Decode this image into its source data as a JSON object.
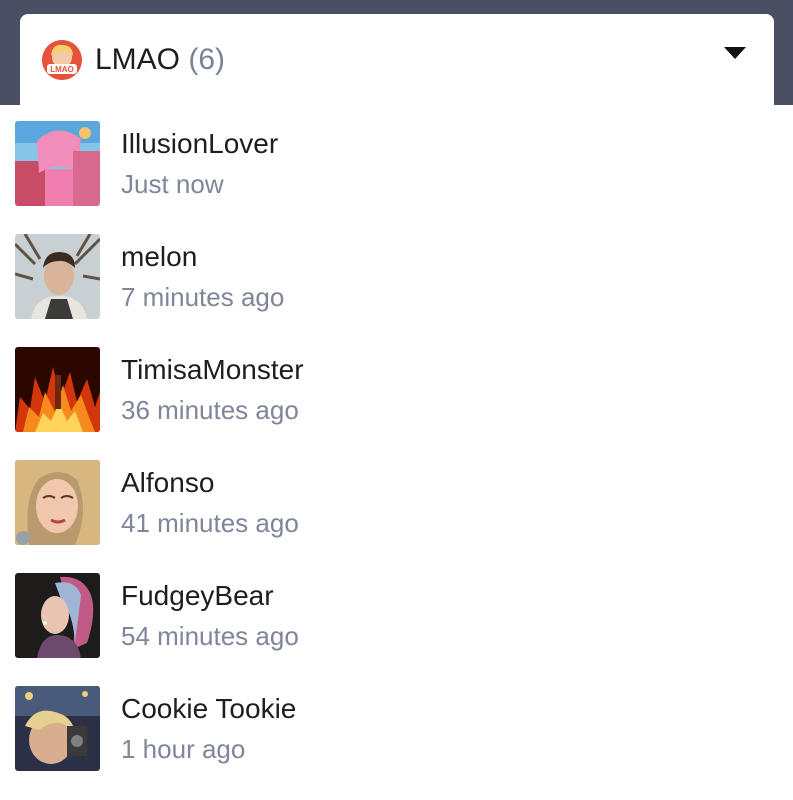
{
  "group": {
    "name": "LMAO",
    "count": "(6)",
    "avatar_text": "LMAO",
    "icon": "chevron-down-icon"
  },
  "colors": {
    "topbar": "#4a5063",
    "username": "#1d1d22",
    "timestamp": "#7f8699",
    "group_avatar": "#e5533a"
  },
  "viewers": [
    {
      "name": "IllusionLover",
      "time": "Just now"
    },
    {
      "name": "melon",
      "time": "7 minutes ago"
    },
    {
      "name": "TimisaMonster",
      "time": "36 minutes ago"
    },
    {
      "name": "Alfonso",
      "time": "41 minutes ago"
    },
    {
      "name": "FudgeyBear",
      "time": "54 minutes ago"
    },
    {
      "name": "Cookie Tookie",
      "time": "1 hour ago"
    }
  ]
}
